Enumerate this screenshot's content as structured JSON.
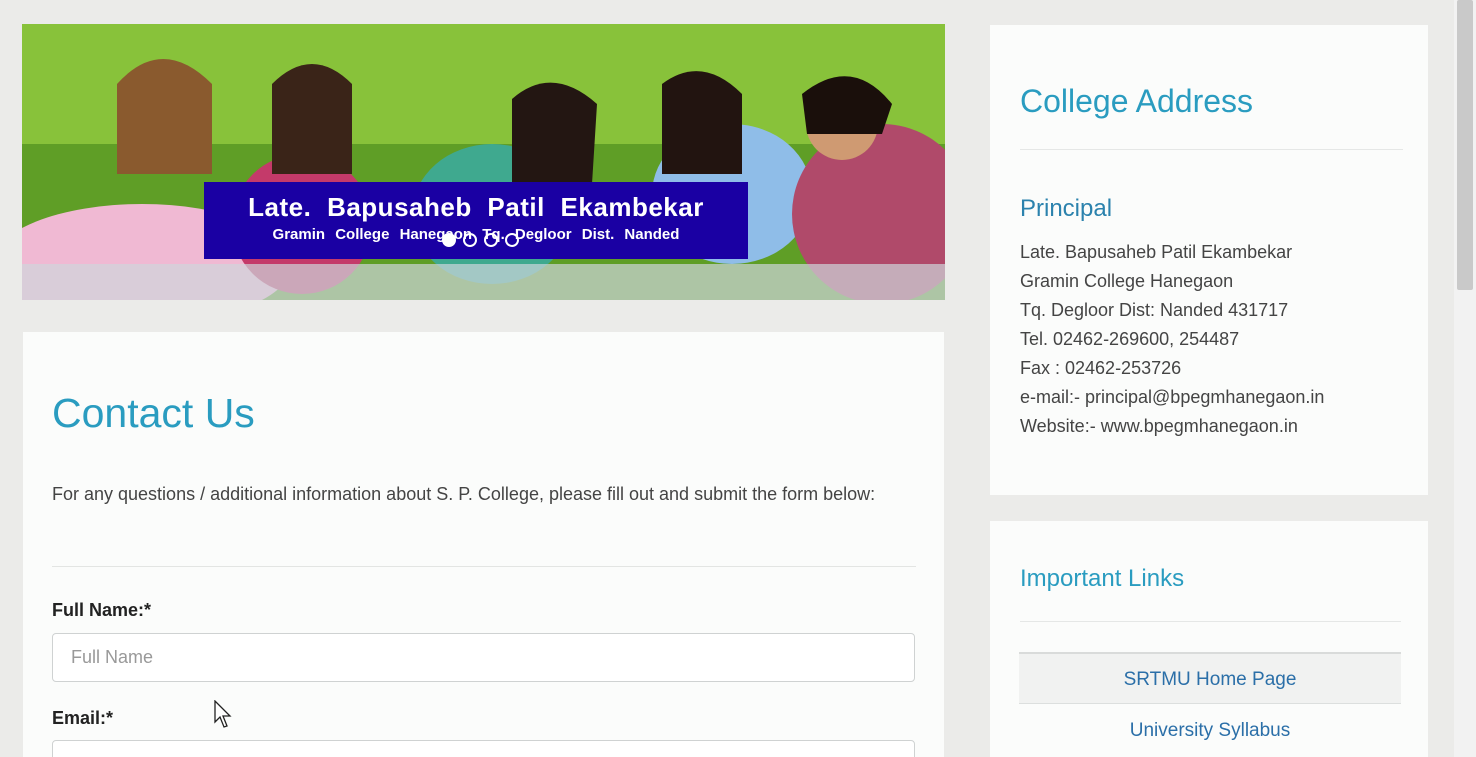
{
  "banner": {
    "line1": "Late.  Bapusaheb  Patil  Ekambekar",
    "line2": "Gramin  College  Hanegaon  Tq.  Degloor  Dist.  Nanded",
    "slides": 4,
    "active_slide": 1
  },
  "contact": {
    "title": "Contact Us",
    "intro": "For any questions / additional information about S. P. College, please fill out and submit the form below:",
    "full_name_label": "Full Name:*",
    "full_name_placeholder": "Full Name",
    "email_label": "Email:*"
  },
  "address": {
    "title": "College Address",
    "subtitle": "Principal",
    "lines": [
      "Late. Bapusaheb Patil Ekambekar",
      "Gramin College Hanegaon",
      "Tq. Degloor Dist: Nanded 431717",
      "Tel. 02462-269600, 254487",
      "Fax : 02462-253726",
      "e-mail:- principal@bpegmhanegaon.in",
      "Website:- www.bpegmhanegaon.in"
    ]
  },
  "links": {
    "title": "Important Links",
    "items": [
      "SRTMU Home Page",
      "University Syllabus"
    ]
  },
  "colors": {
    "accent": "#2a9cc0",
    "caption_bg": "#1a00a3",
    "page_bg": "#ebebe9"
  }
}
